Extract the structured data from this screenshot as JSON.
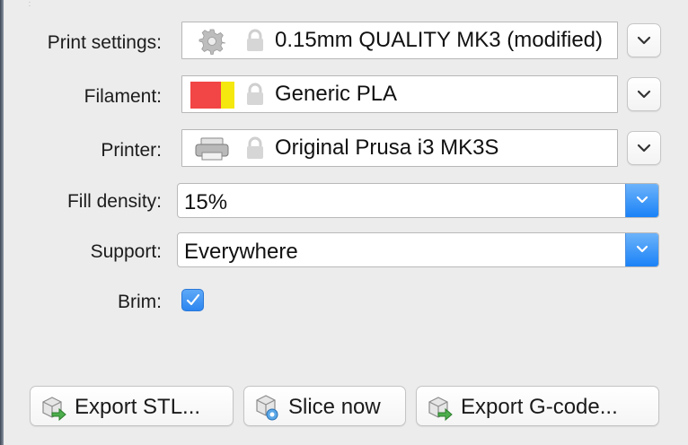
{
  "settings": {
    "print": {
      "label": "Print settings:",
      "value": "0.15mm QUALITY MK3 (modified)",
      "icon": "gear-icon",
      "locked_icon": "lock-icon"
    },
    "filament": {
      "label": "Filament:",
      "value": "Generic PLA",
      "colors": [
        "#f24545",
        "#f4e80e"
      ],
      "locked_icon": "lock-icon"
    },
    "printer": {
      "label": "Printer:",
      "value": "Original Prusa i3 MK3S",
      "icon": "printer-icon",
      "locked_icon": "lock-icon"
    },
    "fill_density": {
      "label": "Fill density:",
      "value": "15%"
    },
    "support": {
      "label": "Support:",
      "value": "Everywhere"
    },
    "brim": {
      "label": "Brim:",
      "checked": true
    }
  },
  "actions": {
    "export_stl": "Export STL...",
    "slice_now": "Slice now",
    "export_gcode": "Export G-code..."
  },
  "colors": {
    "accent": "#1a82f7",
    "panel_bg": "#ececec"
  }
}
